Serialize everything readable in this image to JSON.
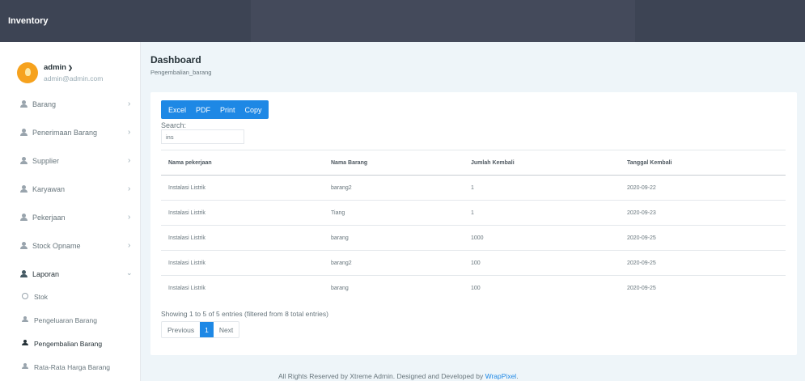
{
  "app": {
    "brand": "Inventory"
  },
  "user": {
    "name": "admin",
    "email": "admin@admin.com"
  },
  "sidebar": {
    "items": [
      {
        "label": "Barang"
      },
      {
        "label": "Penerimaan Barang"
      },
      {
        "label": "Supplier"
      },
      {
        "label": "Karyawan"
      },
      {
        "label": "Pekerjaan"
      },
      {
        "label": "Stock Opname"
      },
      {
        "label": "Laporan"
      }
    ],
    "submenu": [
      {
        "label": "Stok"
      },
      {
        "label": "Pengeluaran Barang"
      },
      {
        "label": "Pengembalian Barang"
      },
      {
        "label": "Rata-Rata Harga Barang"
      }
    ]
  },
  "page": {
    "title": "Dashboard",
    "breadcrumb": "Pengembalian_barang"
  },
  "toolbar": {
    "excel": "Excel",
    "pdf": "PDF",
    "print": "Print",
    "copy": "Copy"
  },
  "search": {
    "label": "Search:",
    "value": "ins"
  },
  "table": {
    "headers": [
      "Nama pekerjaan",
      "Nama Barang",
      "Jumlah Kembali",
      "Tanggal Kembali"
    ],
    "rows": [
      [
        "Instalasi Listrik",
        "barang2",
        "1",
        "2020-09-22"
      ],
      [
        "Instalasi Listrik",
        "Tiang",
        "1",
        "2020-09-23"
      ],
      [
        "Instalasi Listrik",
        "barang",
        "1000",
        "2020-09-25"
      ],
      [
        "Instalasi Listrik",
        "barang2",
        "100",
        "2020-09-25"
      ],
      [
        "Instalasi Listrik",
        "barang",
        "100",
        "2020-09-25"
      ]
    ]
  },
  "pagination": {
    "info": "Showing 1 to 5 of 5 entries (filtered from 8 total entries)",
    "previous": "Previous",
    "current": "1",
    "next": "Next"
  },
  "footer": {
    "text": "All Rights Reserved by Xtreme Admin. Designed and Developed by ",
    "link": "WrapPixel",
    "end": "."
  },
  "colors": {
    "topbar": "#3d4454",
    "accent": "#1e88e5",
    "avatar": "#f6a21e"
  }
}
